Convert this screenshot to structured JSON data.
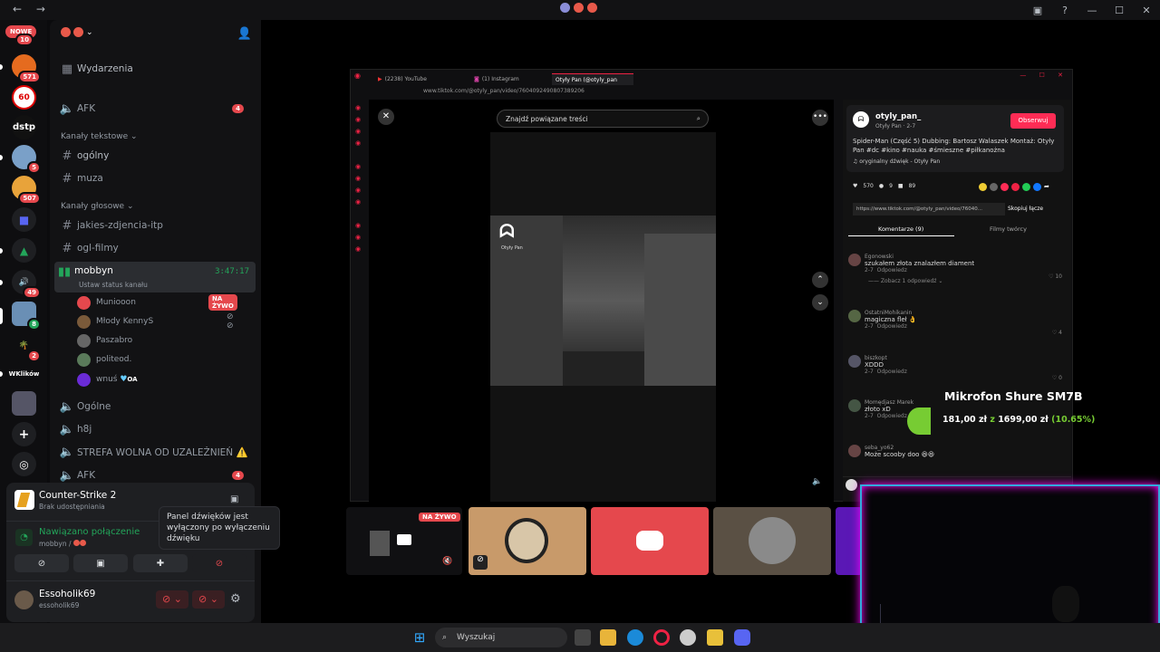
{
  "titlebar": {
    "back": "←",
    "forward": "→"
  },
  "servers": {
    "nowe_label": "NOWE",
    "nowe_count": "10",
    "items": [
      {
        "label": "",
        "count": "571"
      },
      {
        "label": "60",
        "count": ""
      },
      {
        "label": "dstp",
        "count": ""
      },
      {
        "label": "",
        "count": "5"
      },
      {
        "label": "",
        "count": "507"
      },
      {
        "label": "",
        "count": ""
      },
      {
        "label": "",
        "count": ""
      },
      {
        "label": "",
        "count": "49"
      },
      {
        "label": "",
        "count": "8"
      },
      {
        "label": "",
        "count": "2"
      },
      {
        "label": "WKlików",
        "count": ""
      },
      {
        "label": "",
        "count": ""
      },
      {
        "label": "+",
        "count": ""
      },
      {
        "label": "",
        "count": ""
      }
    ]
  },
  "sidebar": {
    "events": "Wydarzenia",
    "afk1": "AFK",
    "afk1_badge": "4",
    "cat_text": "Kanały tekstowe",
    "text_channels": [
      "ogólny",
      "muza"
    ],
    "cat_voice": "Kanały głosowe",
    "voice_channels": [
      "jakies-zdjencia-itp",
      "ogl-filmy"
    ],
    "active_channel": "mobbyn",
    "active_timer": "3:47:17",
    "status_hint": "Ustaw status kanału",
    "users": [
      {
        "name": "Muniooon",
        "live": "NA ŻYWO"
      },
      {
        "name": "Młody KennyS",
        "live": ""
      },
      {
        "name": "Paszabro",
        "live": ""
      },
      {
        "name": "politeod.",
        "live": ""
      },
      {
        "name": "wnuś",
        "live": "",
        "tag": "OA"
      }
    ],
    "more_channels": [
      "Ogólne",
      "h8j",
      "STREFA WOLNA OD UZALEŻNIEŃ ⚠️",
      "AFK"
    ],
    "afk2_badge": "4"
  },
  "game": {
    "title": "Counter-Strike 2",
    "subtitle": "Brak udostępniania"
  },
  "tooltip": "Panel dźwięków jest wyłączony po wyłączeniu dźwięku",
  "connection": {
    "status": "Nawiązano połączenie",
    "channel": "mobbyn /"
  },
  "user": {
    "name": "Essoholik69",
    "handle": "essoholik69"
  },
  "browser": {
    "tabs": [
      "(2238) YouTube",
      "(1) Instagram",
      "Otyły Pan (@otyly_pan"
    ],
    "url": "www.tiktok.com/@otyly_pan/video/7604092490807389206",
    "search_placeholder": "Znajdź powiązane treści",
    "watermark": "Otyły Pan",
    "author": "otyly_pan_",
    "author_sub": "Otyły Pan · 2-7",
    "follow": "Obserwuj",
    "caption": "Spider-Man (Część 5) Dubbing: Bartosz Walaszek Montaż: Otyły Pan #dc #kino #nauka #śmieszne #piłkanożna",
    "sound": "oryginalny dźwięk - Otyły Pan",
    "likes": "570",
    "comments_count": "9",
    "saves": "89",
    "share_url": "https://www.tiktok.com/@otyly_pan/video/76040...",
    "copy_link": "Skopiuj łącze",
    "tab_comments": "Komentarze (9)",
    "tab_creator": "Filmy twórcy",
    "reply": "Odpowiedz",
    "see_replies": "Zobacz 1 odpowiedź",
    "comments": [
      {
        "user": "Egonowski",
        "text": "szukałem złota znalazłem diament",
        "date": "2-7",
        "likes": "10"
      },
      {
        "user": "OstatniMohikanin",
        "text": "magiczna fleł 👌",
        "date": "2-7",
        "likes": "4"
      },
      {
        "user": "biszkopt",
        "text": "XDDD",
        "date": "2-7",
        "likes": "0"
      },
      {
        "user": "Momędjasz Marek",
        "text": "złoto xD",
        "date": "2-7",
        "likes": ""
      },
      {
        "user": "seba_yo62",
        "text": "Może scooby doo 😆😆",
        "date": "2-7",
        "likes": ""
      }
    ]
  },
  "streams": {
    "live": "NA ŻYWO"
  },
  "promo": {
    "title": "Mikrofon Shure SM7B",
    "price": "181,00 zł",
    "from": "z",
    "old_price": "1699,00 zł",
    "percent": "(10.65%)"
  },
  "taskbar": {
    "search": "Wyszukaj"
  },
  "colors": {
    "accent": "#5865f2",
    "danger": "#e5484d",
    "online": "#23a55a",
    "tiktok": "#fe2c55"
  }
}
